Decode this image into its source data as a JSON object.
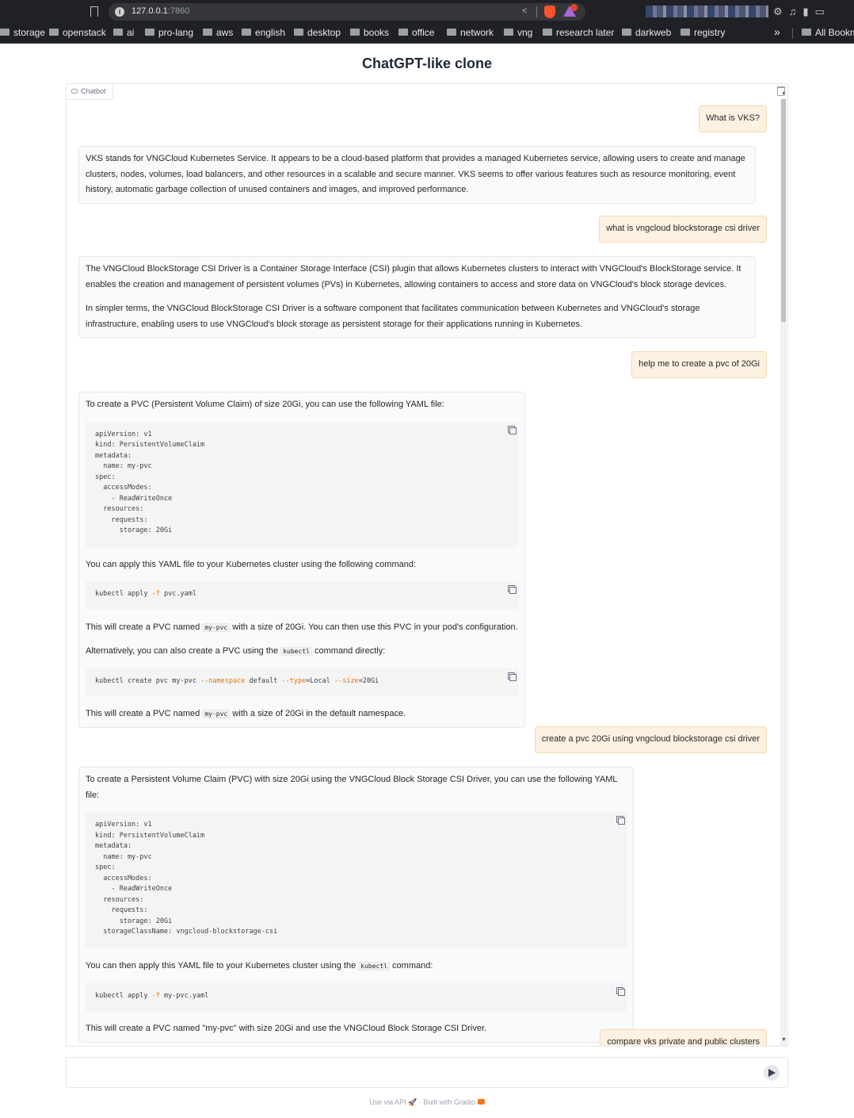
{
  "browser": {
    "url_host": "127.0.0.1",
    "url_port": ":7860",
    "bookmarks": [
      "storage",
      "openstack",
      "ai",
      "pro-lang",
      "aws",
      "english",
      "desktop",
      "books",
      "office",
      "network",
      "vng",
      "research later",
      "darkweb",
      "registry"
    ],
    "bookmarks_more": "»",
    "all_bookmarks": "All Bookm"
  },
  "page": {
    "title": "ChatGPT-like clone",
    "chatbot_label": "Chatbot"
  },
  "messages": {
    "m1": "What is VKS?",
    "m2": "VKS stands for VNGCloud Kubernetes Service. It appears to be a cloud-based platform that provides a managed Kubernetes service, allowing users to create and manage clusters, nodes, volumes, load balancers, and other resources in a scalable and secure manner. VKS seems to offer various features such as resource monitoring, event history, automatic garbage collection of unused containers and images, and improved performance.",
    "m3": "what is vngcloud blockstorage csi driver",
    "m4_p1": "The VNGCloud BlockStorage CSI Driver is a Container Storage Interface (CSI) plugin that allows Kubernetes clusters to interact with VNGCloud's BlockStorage service. It enables the creation and management of persistent volumes (PVs) in Kubernetes, allowing containers to access and store data on VNGCloud's block storage devices.",
    "m4_p2": "In simpler terms, the VNGCloud BlockStorage CSI Driver is a software component that facilitates communication between Kubernetes and VNGCloud's storage infrastructure, enabling users to use VNGCloud's block storage as persistent storage for their applications running in Kubernetes.",
    "m5": "help me to create a pvc of 20Gi",
    "m6_p1": "To create a PVC (Persistent Volume Claim) of size 20Gi, you can use the following YAML file:",
    "m6_code1": "apiVersion: v1\nkind: PersistentVolumeClaim\nmetadata:\n  name: my-pvc\nspec:\n  accessModes:\n    - ReadWriteOnce\n  resources:\n    requests:\n      storage: 20Gi",
    "m6_p2": "You can apply this YAML file to your Kubernetes cluster using the following command:",
    "m6_code2_a": "kubectl apply ",
    "m6_code2_flag": "-f",
    "m6_code2_b": " pvc.yaml",
    "m6_p3_a": "This will create a PVC named ",
    "m6_p3_code": "my-pvc",
    "m6_p3_b": " with a size of 20Gi. You can then use this PVC in your pod's configuration.",
    "m6_p4_a": "Alternatively, you can also create a PVC using the ",
    "m6_p4_code": "kubectl",
    "m6_p4_b": " command directly:",
    "m6_code3_a": "kubectl create pvc my-pvc ",
    "m6_code3_f1": "--namespace",
    "m6_code3_b": " default ",
    "m6_code3_f2": "--type",
    "m6_code3_c": "=Local ",
    "m6_code3_f3": "--size",
    "m6_code3_d": "=20Gi",
    "m6_p5_a": "This will create a PVC named ",
    "m6_p5_code": "my-pvc",
    "m6_p5_b": " with a size of 20Gi in the default namespace.",
    "m7": "create a pvc 20Gi using vngcloud blockstorage csi driver",
    "m8_p1": "To create a Persistent Volume Claim (PVC) with size 20Gi using the VNGCloud Block Storage CSI Driver, you can use the following YAML file:",
    "m8_code1": "apiVersion: v1\nkind: PersistentVolumeClaim\nmetadata:\n  name: my-pvc\nspec:\n  accessModes:\n    - ReadWriteOnce\n  resources:\n    requests:\n      storage: 20Gi\n  storageClassName: vngcloud-blockstorage-csi",
    "m8_p2_a": "You can then apply this YAML file to your Kubernetes cluster using the ",
    "m8_p2_code": "kubectl",
    "m8_p2_b": " command:",
    "m8_code2_a": "kubectl apply ",
    "m8_code2_flag": "-f",
    "m8_code2_b": " my-pvc.yaml",
    "m8_p3": "This will create a PVC named \"my-pvc\" with size 20Gi and use the VNGCloud Block Storage CSI Driver.",
    "m9": "compare vks private and public clusters"
  },
  "input": {
    "placeholder": ""
  },
  "footer": {
    "api": "Use via API",
    "dot": "·",
    "built": "Built with Gradio"
  }
}
